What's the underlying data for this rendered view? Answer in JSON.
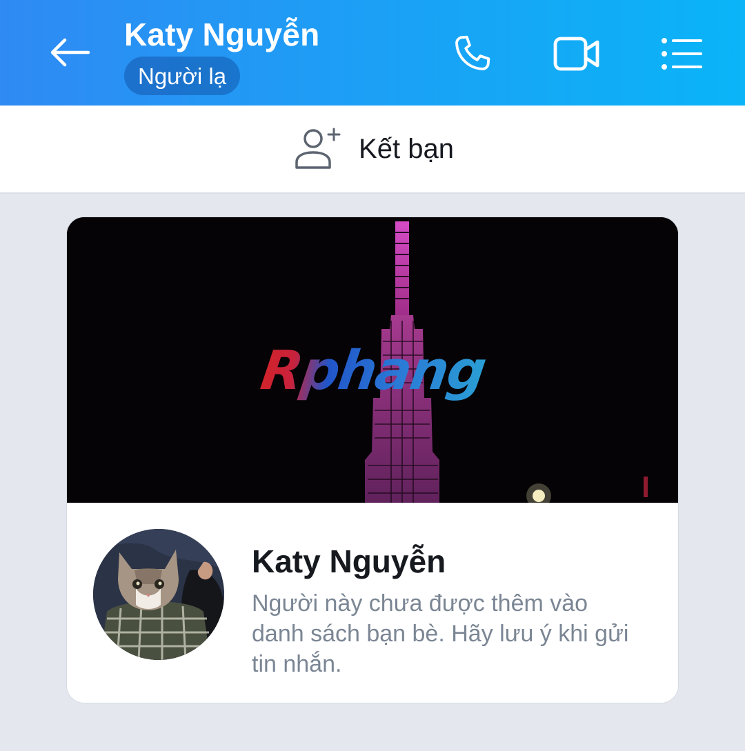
{
  "header": {
    "contact_name": "Katy Nguyễn",
    "badge": "Người lạ",
    "icons": [
      "back-arrow-icon",
      "phone-icon",
      "video-camera-icon",
      "list-menu-icon"
    ]
  },
  "add_friend": {
    "label": "Kết bạn",
    "icon": "add-user-icon"
  },
  "profile_card": {
    "cover_watermark": "Rphang",
    "name": "Katy Nguyễn",
    "note": "Người này chưa được thêm vào danh sách bạn bè. Hãy lưu ý khi gửi tin nhắn."
  },
  "colors": {
    "header_start": "#2f8af3",
    "header_end": "#0ab4f7",
    "background": "#e4e8ee",
    "note_text": "#7b8694"
  }
}
